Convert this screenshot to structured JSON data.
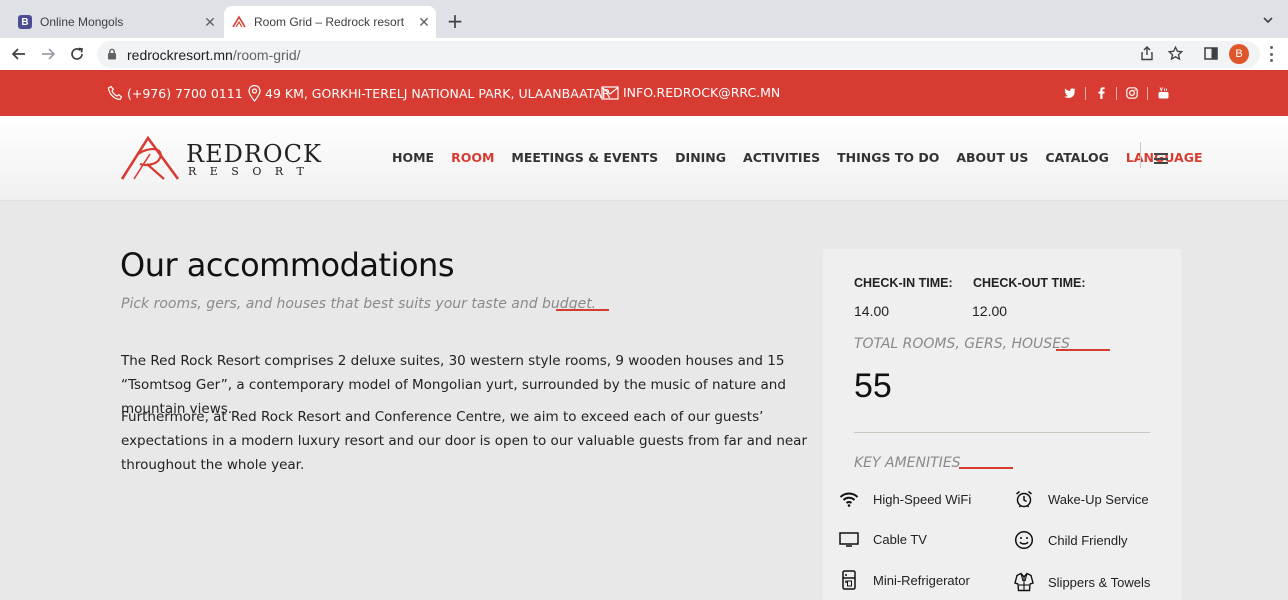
{
  "browser": {
    "tabs": [
      {
        "title": "Online Mongols",
        "favicon": "B"
      },
      {
        "title": "Room Grid – Redrock resort"
      }
    ],
    "url_domain": "redrockresort.mn",
    "url_path": "/room-grid/",
    "profile_initial": "B"
  },
  "topbar": {
    "phone": "(+976) 7700 0111",
    "address": "49 KM, GORKHI-TERELJ NATIONAL PARK, ULAANBAATAR",
    "email": "INFO.REDROCK@RRC.MN",
    "socials": [
      "twitter-icon",
      "facebook-icon",
      "instagram-icon",
      "youtube-icon"
    ]
  },
  "logo": {
    "brand": "REDROCK",
    "sub": "RESORT",
    "mark_text": "RESORT"
  },
  "nav": {
    "items": [
      "HOME",
      "ROOM",
      "MEETINGS & EVENTS",
      "DINING",
      "ACTIVITIES",
      "THINGS TO DO",
      "ABOUT US",
      "CATALOG",
      "LANGUAGE"
    ],
    "active": "ROOM"
  },
  "main": {
    "title": "Our accommodations",
    "subtitle": "Pick rooms, gers, and houses that best suits your taste and budget.",
    "paragraphs": [
      "The Red Rock Resort comprises 2 deluxe suites, 30 western style rooms, 9 wooden houses and 15 “Tsomtsog Ger”, a contemporary model of Mongolian yurt, surrounded by the music of nature and mountain views.",
      "Furthermore, at Red Rock Resort and Conference Centre, we aim to exceed each of our guests’ expectations in a modern luxury resort and our door is open to our valuable guests from far and near throughout the whole year."
    ]
  },
  "panel": {
    "checkin_label": "CHECK-IN TIME:",
    "checkin_value": "14.00",
    "checkout_label": "CHECK-OUT TIME:",
    "checkout_value": "12.00",
    "total_label": "TOTAL ROOMS, GERS, HOUSES",
    "total_value": "55",
    "amenities_label": "KEY AMENITIES",
    "amenities": [
      {
        "label": "High-Speed WiFi",
        "icon": "wifi-icon"
      },
      {
        "label": "Wake-Up Service",
        "icon": "alarm-clock-icon"
      },
      {
        "label": "Cable TV",
        "icon": "tv-icon"
      },
      {
        "label": "Child Friendly",
        "icon": "smiley-icon"
      },
      {
        "label": "Mini-Refrigerator",
        "icon": "refrigerator-icon"
      },
      {
        "label": "Slippers & Towels",
        "icon": "bathrobe-icon"
      }
    ]
  },
  "colors": {
    "brand_red": "#d73b31",
    "page_bg": "#e8e8e8",
    "panel_bg": "#efefef"
  }
}
